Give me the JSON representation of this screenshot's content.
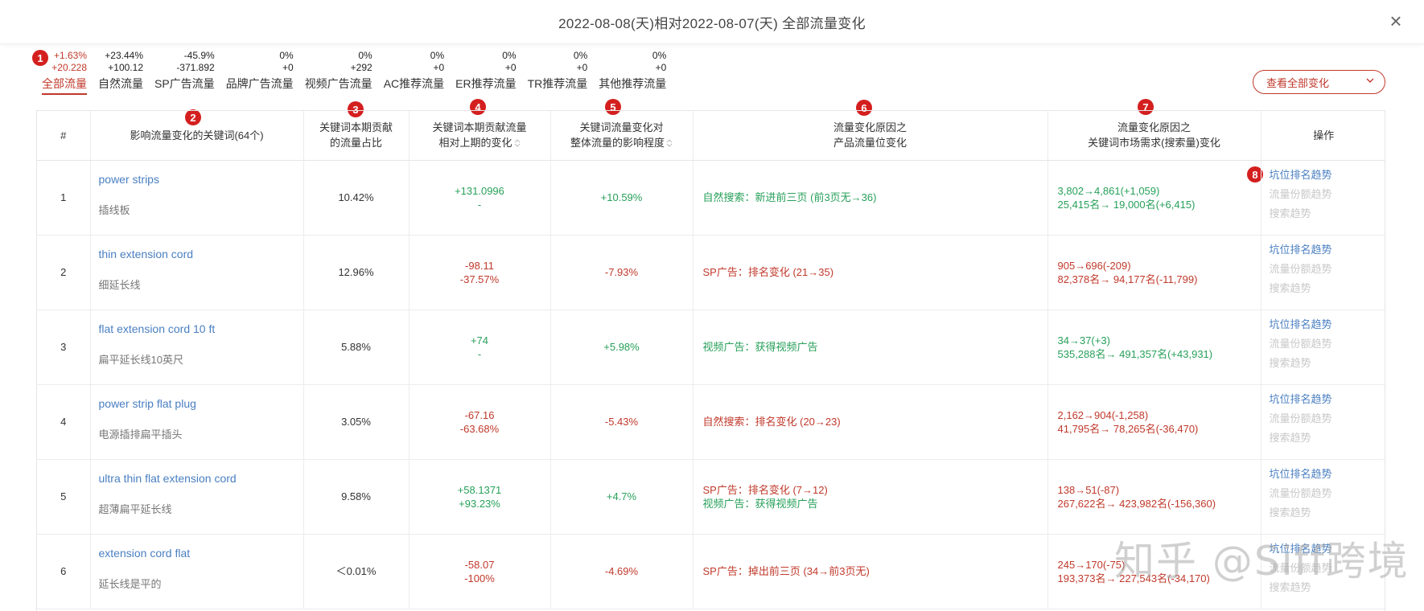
{
  "modal": {
    "title": "2022-08-08(天)相对2022-08-07(天) 全部流量变化",
    "close_glyph": "×"
  },
  "badges": [
    "1",
    "2",
    "3",
    "4",
    "5",
    "6",
    "7",
    "8"
  ],
  "tabs": [
    {
      "label": "全部流量",
      "pct": "+1.63%",
      "abs": "+20.228",
      "active": true
    },
    {
      "label": "自然流量",
      "pct": "+23.44%",
      "abs": "+100.12",
      "active": false
    },
    {
      "label": "SP广告流量",
      "pct": "-45.9%",
      "abs": "-371.892",
      "active": false
    },
    {
      "label": "品牌广告流量",
      "pct": "0%",
      "abs": "+0",
      "active": false
    },
    {
      "label": "视频广告流量",
      "pct": "0%",
      "abs": "+292",
      "active": false
    },
    {
      "label": "AC推荐流量",
      "pct": "0%",
      "abs": "+0",
      "active": false
    },
    {
      "label": "ER推荐流量",
      "pct": "0%",
      "abs": "+0",
      "active": false
    },
    {
      "label": "TR推荐流量",
      "pct": "0%",
      "abs": "+0",
      "active": false
    },
    {
      "label": "其他推荐流量",
      "pct": "0%",
      "abs": "+0",
      "active": false
    }
  ],
  "view_select": {
    "label": "查看全部变化"
  },
  "table": {
    "headers": [
      "#",
      "影响流量变化的关键词(64个)",
      "关键词本期贡献\n的流量占比",
      "关键词本期贡献流量\n相对上期的变化",
      "关键词流量变化对\n整体流量的影响程度",
      "流量变化原因之\n产品流量位变化",
      "流量变化原因之\n关键词市场需求(搜索量)变化",
      "操作"
    ],
    "ops": [
      "坑位排名趋势",
      "流量份额趋势",
      "搜索趋势"
    ],
    "rows": [
      {
        "idx": "1",
        "en": "power strips",
        "cn": "插线板",
        "share": "10.42%",
        "chg1": "+131.0996",
        "chg2": "-",
        "chg_color": "pos",
        "impact": "+10.59%",
        "impact_color": "pos",
        "reason": [
          {
            "t": "自然搜索：新进前三页 (前3页无→36)",
            "c": "pos"
          }
        ],
        "market": [
          {
            "t": "3,802→4,861(+1,059)",
            "c": "pos"
          },
          {
            "t": "25,415名→ 19,000名(+6,415)",
            "c": "pos"
          }
        ]
      },
      {
        "idx": "2",
        "en": "thin extension cord",
        "cn": "细延长线",
        "share": "12.96%",
        "chg1": "-98.11",
        "chg2": "-37.57%",
        "chg_color": "neg",
        "impact": "-7.93%",
        "impact_color": "neg",
        "reason": [
          {
            "t": "SP广告：排名变化 (21→35)",
            "c": "neg"
          }
        ],
        "market": [
          {
            "t": "905→696(-209)",
            "c": "neg"
          },
          {
            "t": "82,378名→ 94,177名(-11,799)",
            "c": "neg"
          }
        ]
      },
      {
        "idx": "3",
        "en": "flat extension cord 10 ft",
        "cn": "扁平延长线10英尺",
        "share": "5.88%",
        "chg1": "+74",
        "chg2": "-",
        "chg_color": "pos",
        "impact": "+5.98%",
        "impact_color": "pos",
        "reason": [
          {
            "t": "视频广告：获得视频广告",
            "c": "pos"
          }
        ],
        "market": [
          {
            "t": "34→37(+3)",
            "c": "pos"
          },
          {
            "t": "535,288名→ 491,357名(+43,931)",
            "c": "pos"
          }
        ]
      },
      {
        "idx": "4",
        "en": "power strip flat plug",
        "cn": "电源插排扁平插头",
        "share": "3.05%",
        "chg1": "-67.16",
        "chg2": "-63.68%",
        "chg_color": "neg",
        "impact": "-5.43%",
        "impact_color": "neg",
        "reason": [
          {
            "t": "自然搜索：排名变化 (20→23)",
            "c": "neg"
          }
        ],
        "market": [
          {
            "t": "2,162→904(-1,258)",
            "c": "neg"
          },
          {
            "t": "41,795名→ 78,265名(-36,470)",
            "c": "neg"
          }
        ]
      },
      {
        "idx": "5",
        "en": "ultra thin flat extension cord",
        "cn": "超薄扁平延长线",
        "share": "9.58%",
        "chg1": "+58.1371",
        "chg2": "+93.23%",
        "chg_color": "pos",
        "impact": "+4.7%",
        "impact_color": "pos",
        "reason": [
          {
            "t": "SP广告：排名变化 (7→12)",
            "c": "neg"
          },
          {
            "t": "视频广告：获得视频广告",
            "c": "pos"
          }
        ],
        "market": [
          {
            "t": "138→51(-87)",
            "c": "neg"
          },
          {
            "t": "267,622名→ 423,982名(-156,360)",
            "c": "neg"
          }
        ]
      },
      {
        "idx": "6",
        "en": "extension cord flat",
        "cn": "延长线是平的",
        "share": "＜0.01%",
        "chg1": "-58.07",
        "chg2": "-100%",
        "chg_color": "neg",
        "impact": "-4.69%",
        "impact_color": "neg",
        "reason": [
          {
            "t": "SP广告：掉出前三页 (34→前3页无)",
            "c": "neg"
          }
        ],
        "market": [
          {
            "t": "245→170(-75)",
            "c": "neg"
          },
          {
            "t": "193,373名→ 227,543名(-34,170)",
            "c": "neg"
          }
        ]
      }
    ]
  },
  "watermark": "知乎 @Siff跨境"
}
